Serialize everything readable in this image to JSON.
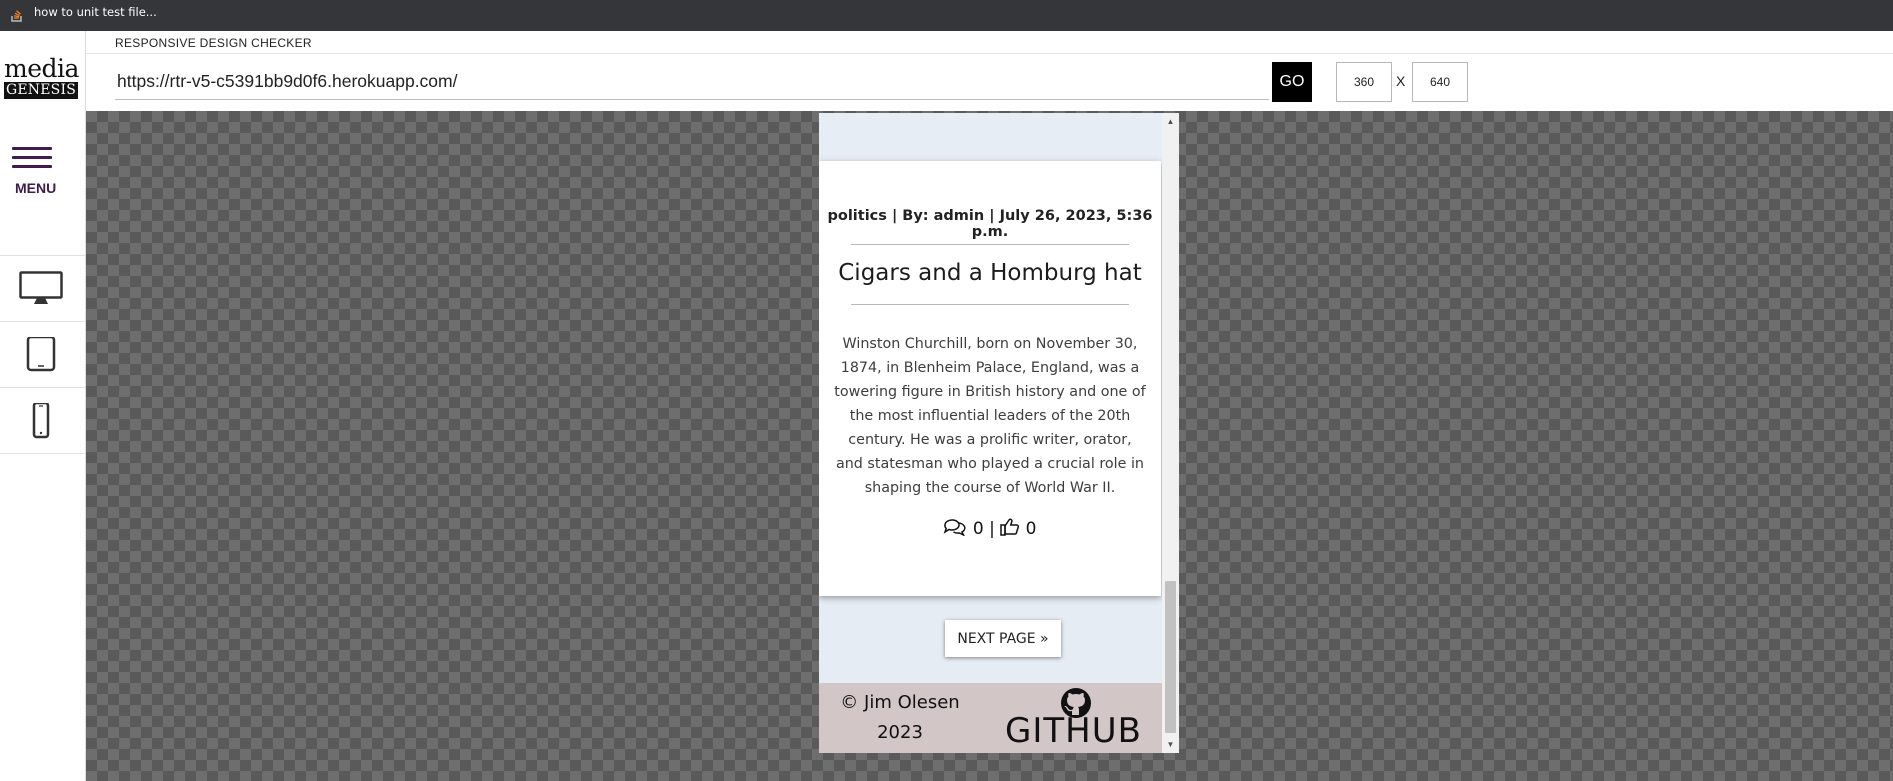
{
  "browser": {
    "tab_title": "how to unit test file..."
  },
  "sidebar": {
    "logo_media": "media",
    "logo_genesis": "GENESIS",
    "menu_label": "MENU",
    "devices": [
      "desktop-icon",
      "tablet-icon",
      "phone-icon"
    ]
  },
  "header": {
    "app_title": "RESPONSIVE DESIGN CHECKER",
    "url": "https://rtr-v5-c5391bb9d0f6.herokuapp.com/",
    "go_label": "GO",
    "width": "360",
    "height": "640",
    "dim_separator": "X"
  },
  "site": {
    "post": {
      "meta": "politics | By: admin | July 26, 2023, 5:36 p.m.",
      "title": "Cigars and a Homburg hat",
      "body": "Winston Churchill, born on November 30, 1874, in Blenheim Palace, England, was a towering figure in British history and one of the most influential leaders of the 20th century. He was a prolific writer, orator, and statesman who played a crucial role in shaping the course of World War II.",
      "comments": "0",
      "stats_separator": "|",
      "likes": "0"
    },
    "next_page_label": "NEXT PAGE »",
    "footer": {
      "copyright_line1": "© Jim Olesen",
      "copyright_line2": "2023",
      "github_label": "GITHUB"
    }
  },
  "colors": {
    "menu_accent": "#3f1c4d",
    "footer_bg": "#d2c6c7",
    "page_bg": "#e5ecf3",
    "tabbar_bg": "#35363a"
  }
}
